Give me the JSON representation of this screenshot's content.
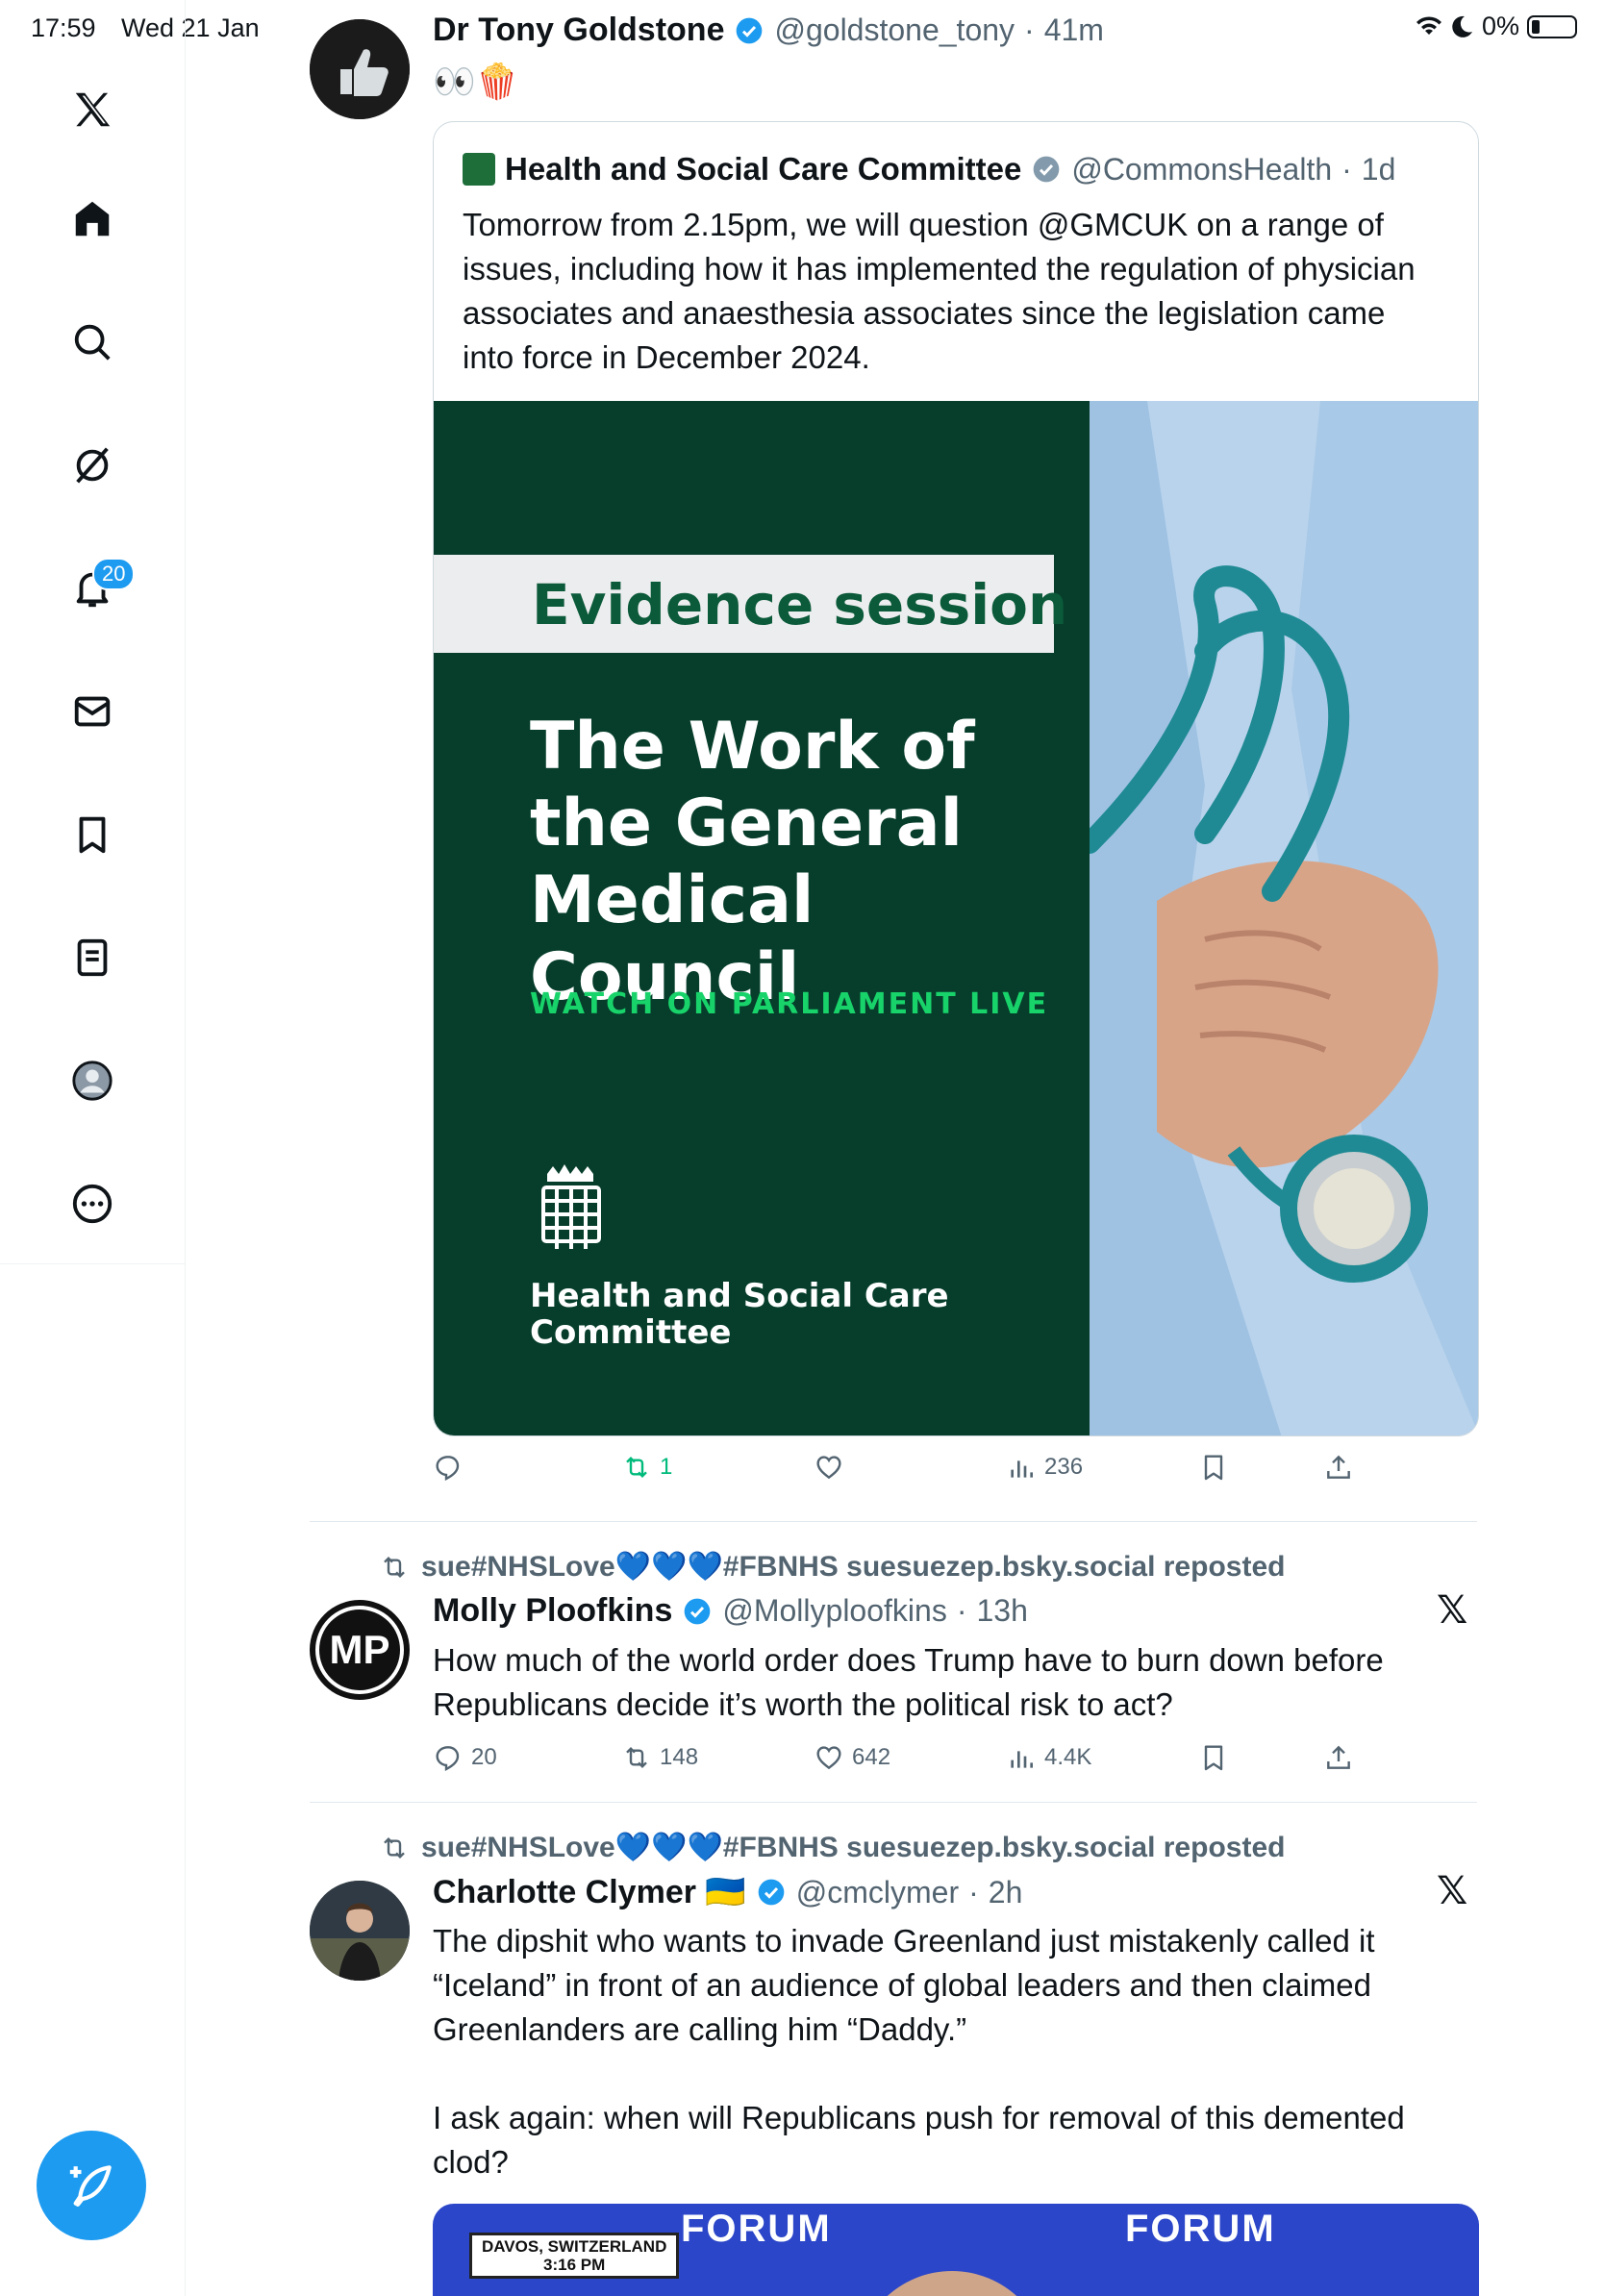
{
  "status_bar": {
    "time": "17:59",
    "date": "Wed 21 Jan",
    "battery": "0%"
  },
  "sidebar": {
    "notifications_badge": "20",
    "items": [
      {
        "name": "x-logo-icon"
      },
      {
        "name": "home-icon"
      },
      {
        "name": "search-icon"
      },
      {
        "name": "grok-icon"
      },
      {
        "name": "notifications-icon"
      },
      {
        "name": "messages-icon"
      },
      {
        "name": "bookmarks-icon"
      },
      {
        "name": "lists-icon"
      },
      {
        "name": "profile-icon"
      },
      {
        "name": "more-icon"
      }
    ]
  },
  "posts": [
    {
      "author": "Dr Tony Goldstone",
      "handle": "@goldstone_tony",
      "time": "41m",
      "text": "👀🍿",
      "quote": {
        "author": "Health and Social Care Committee",
        "handle": "@CommonsHealth",
        "time": "1d",
        "text": "Tomorrow from 2.15pm, we will question @GMCUK on a range of issues, including how it has implemented the regulation of physician associates and anaesthesia associates since the legislation came into force in December 2024.",
        "image": {
          "label": "Evidence session",
          "title": "The Work of the General Medical Council",
          "subtitle": "WATCH ON PARLIAMENT LIVE",
          "org": "Health and Social Care Committee"
        }
      },
      "stats": {
        "replies": "",
        "reposts": "1",
        "likes": "",
        "views": "236"
      }
    },
    {
      "reposted_by": "sue#NHSLove💙💙💙#FBNHS suesuezep.bsky.social reposted",
      "author": "Molly Ploofkins",
      "avatar_initials": "MP",
      "handle": "@Mollyploofkins",
      "time": "13h",
      "text": "How much of the world order does Trump have to burn down before Republicans decide it’s worth the political risk to act?",
      "stats": {
        "replies": "20",
        "reposts": "148",
        "likes": "642",
        "views": "4.4K"
      }
    },
    {
      "reposted_by": "sue#NHSLove💙💙💙#FBNHS suesuezep.bsky.social reposted",
      "author": "Charlotte Clymer 🇺🇦",
      "handle": "@cmclymer",
      "time": "2h",
      "text_1": "The dipshit who wants to invade Greenland just mistakenly called it “Iceland” in front of an audience of global leaders and then claimed Greenlanders are calling him “Daddy.”",
      "text_2": "I ask again: when will Republicans push for removal of this demented clod?",
      "image": {
        "location": "DAVOS, SWITZERLAND",
        "clock": "3:16 PM",
        "banner": "FORUM"
      }
    }
  ],
  "colors": {
    "accent": "#1d9bf0",
    "repost_green": "#00ba7c",
    "card_green": "#063d2b"
  }
}
